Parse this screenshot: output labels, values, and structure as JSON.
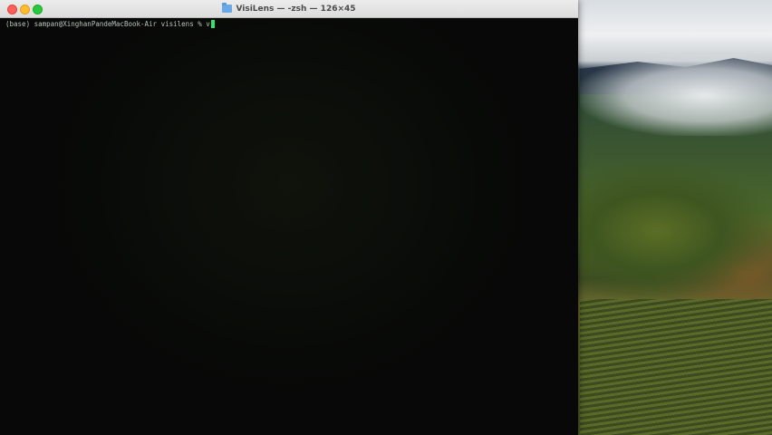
{
  "window": {
    "title": "VisiLens — -zsh — 126×45",
    "folder_icon": "folder-icon"
  },
  "terminal": {
    "prompt": "(base) sampan@XinghanPandeMacBook-Air visilens % ",
    "typed": "v",
    "cursor_color": "#36e36a",
    "background": "#070807"
  },
  "titlebar_buttons": {
    "close_color": "#fe5f57",
    "minimize_color": "#febc2e",
    "zoom_color": "#28c840"
  }
}
